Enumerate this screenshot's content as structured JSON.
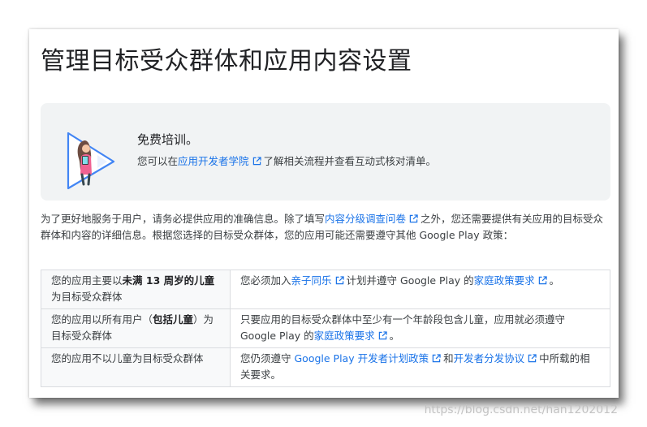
{
  "page": {
    "title": "管理目标受众群体和应用内容设置"
  },
  "callout": {
    "title": "免费培训。",
    "body_prefix": "您可以在",
    "link": "应用开发者学院",
    "body_suffix": "了解相关流程并查看互动式核对清单。",
    "illustration_icon": "academy-illustration-icon"
  },
  "intro": {
    "part1": "为了更好地服务于用户，请务必提供应用的准确信息。除了填写",
    "link": "内容分级调查问卷",
    "part2": "之外，您还需要提供有关应用的目标受众群体和内容的详细信息。根据您选择的目标受众群体，您的应用可能还需要遵守其他 Google Play 政策："
  },
  "table": {
    "rows": [
      {
        "left_a": "您的应用主要以",
        "left_bold": "未满 13 周岁的儿童",
        "left_b": "为目标受众群体",
        "right_a": "您必须加入",
        "right_link1": "亲子同乐",
        "right_b": "计划并遵守 Google Play 的",
        "right_link2": "家庭政策要求",
        "right_c": "。"
      },
      {
        "left_a": "您的应用以所有用户（",
        "left_bold": "包括儿童",
        "left_b": "）为目标受众群体",
        "right_a": "只要应用的目标受众群体中至少有一个年龄段包含儿童，应用就必须遵守 Google Play 的",
        "right_link1": "家庭政策要求",
        "right_b": "。"
      },
      {
        "left_a": "您的应用不以儿童为目标受众群体",
        "right_a": "您仍须遵守 ",
        "right_link1": "Google Play 开发者计划政策",
        "right_b": "和",
        "right_link2": "开发者分发协议",
        "right_c": "中所载的相关要求。"
      }
    ]
  },
  "watermark": "https://blog.csdn.net/han1202012",
  "colors": {
    "link": "#1a73e8",
    "callout_bg": "#f1f3f4",
    "table_border": "#dadce0"
  }
}
